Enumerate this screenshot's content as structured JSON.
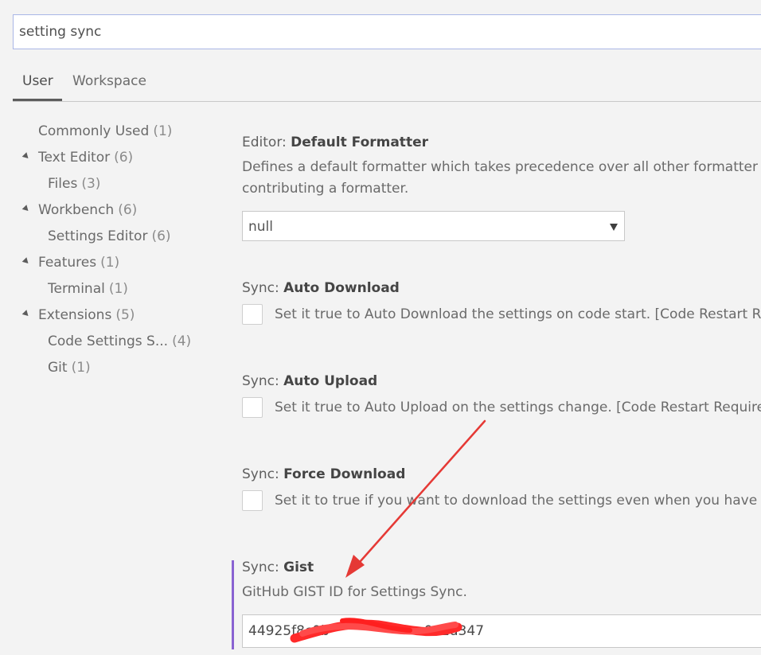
{
  "search": {
    "value": "setting sync"
  },
  "tabs": {
    "user": "User",
    "workspace": "Workspace"
  },
  "toc": {
    "items": [
      {
        "label": "Commonly Used",
        "count": "(1)"
      },
      {
        "label": "Text Editor",
        "count": "(6)"
      },
      {
        "label": "Files",
        "count": "(3)"
      },
      {
        "label": "Workbench",
        "count": "(6)"
      },
      {
        "label": "Settings Editor",
        "count": "(6)"
      },
      {
        "label": "Features",
        "count": "(1)"
      },
      {
        "label": "Terminal",
        "count": "(1)"
      },
      {
        "label": "Extensions",
        "count": "(5)"
      },
      {
        "label": "Code Settings S...",
        "count": "(4)"
      },
      {
        "label": "Git",
        "count": "(1)"
      }
    ]
  },
  "settings": {
    "default_formatter": {
      "category": "Editor: ",
      "name": "Default Formatter",
      "description_line1": "Defines a default formatter which takes precedence over all other formatter",
      "description_line2": "contributing a formatter.",
      "value": "null"
    },
    "auto_download": {
      "category": "Sync: ",
      "name": "Auto Download",
      "description": "Set it true to Auto Download the settings on code start. [Code Restart R"
    },
    "auto_upload": {
      "category": "Sync: ",
      "name": "Auto Upload",
      "description": "Set it true to Auto Upload on the settings change. [Code Restart Require"
    },
    "force_download": {
      "category": "Sync: ",
      "name": "Force Download",
      "description": "Set it to true if you want to download the settings even when you have"
    },
    "gist": {
      "category": "Sync: ",
      "name": "Gist",
      "description": "GitHub GIST ID for Settings Sync.",
      "value": "44925f8c0b                      0a1d347"
    }
  },
  "colors": {
    "focus_bar": "#8a63d2",
    "annotation": "#e53935"
  }
}
